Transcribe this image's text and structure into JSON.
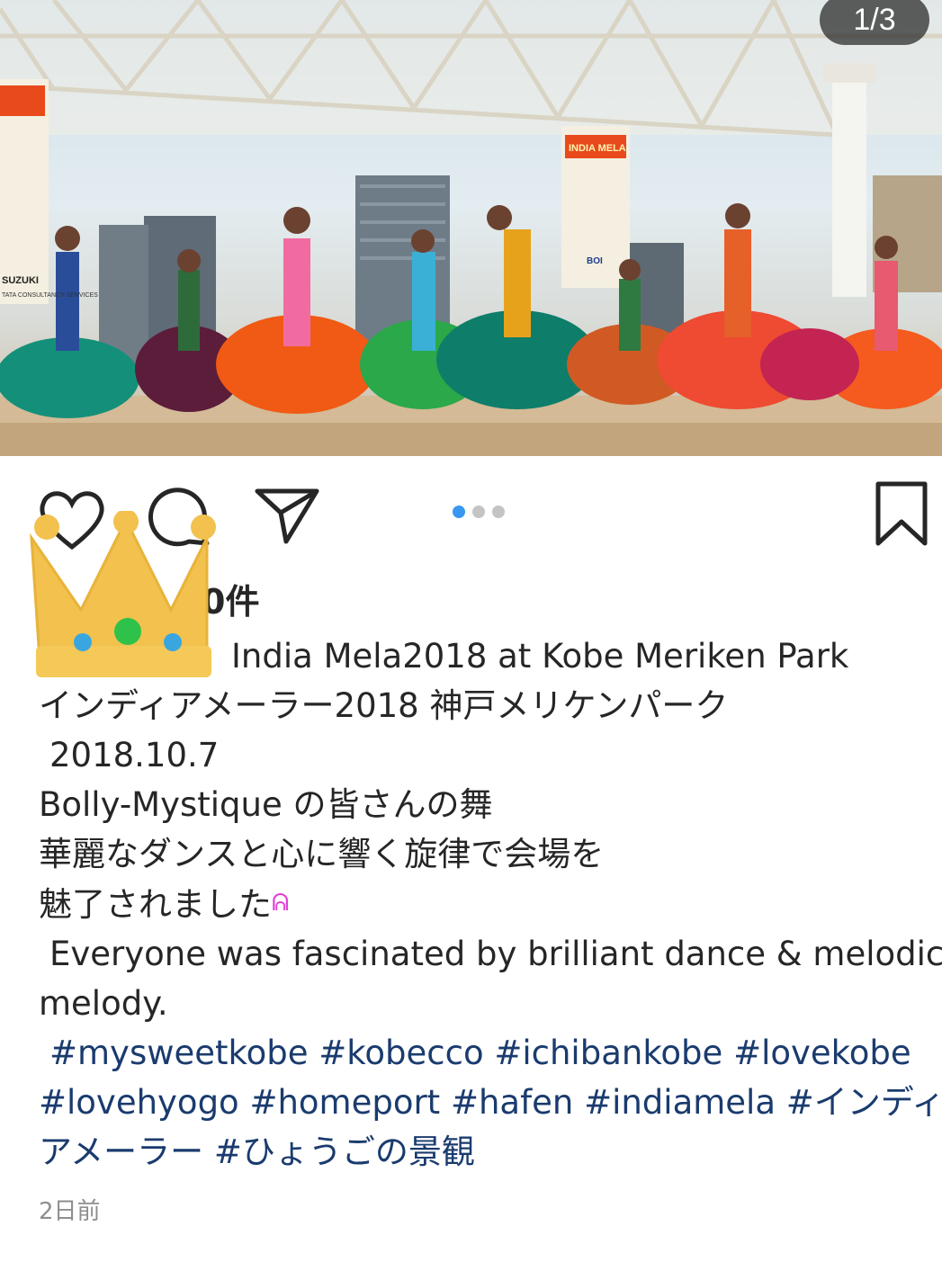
{
  "post": {
    "counter": "1/3",
    "likes_text": "0件",
    "caption": {
      "line1": "India Mela2018 at Kobe Meriken Park",
      "line2": "インディアメーラー2018 神戸メリケンパーク",
      "line3": "2018.10.7",
      "line4": "Bolly-Mystique の皆さんの舞",
      "line5": "華麗なダンスと心に響く旋律で会場を",
      "line6": "魅了されました",
      "line6_emoji": "ᕱ",
      "line7": "Everyone was fascinated by brilliant dance & melodic",
      "line8": "melody."
    },
    "hashtags": {
      "line1": "#mysweetkobe #kobecco #ichibankobe #lovekobe",
      "line2": "#lovehyogo #homeport #hafen #indiamela #インディ",
      "line3": "アメーラー #ひょうごの景観"
    },
    "timestamp": "2日前"
  },
  "photo": {
    "banner_text": "INDIA MELA",
    "sponsor_texts": [
      "SUZUKI",
      "TATA CONSULTANCY SERVICES",
      "BOI"
    ]
  },
  "icons": {
    "like": "heart-icon",
    "comment": "comment-icon",
    "share": "paper-plane-icon",
    "save": "bookmark-icon",
    "overlay": "crown-sticker"
  },
  "colors": {
    "active_dot": "#3897f0",
    "hashtag": "#1a3b6e",
    "timestamp": "#8e8e8e"
  },
  "carousel": {
    "current": 1,
    "total": 3
  }
}
